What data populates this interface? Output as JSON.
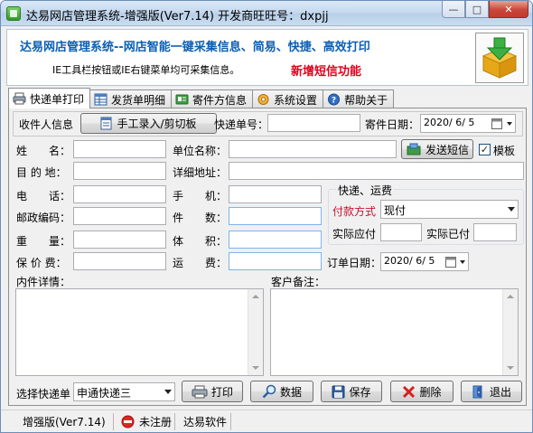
{
  "window": {
    "title": "达易网店管理系统-增强版(Ver7.14) 开发商旺旺号：dxpjj",
    "minimize": "—",
    "maximize": "□",
    "close": "✕"
  },
  "banner": {
    "headline": "达易网店管理系统--网店智能一键采集信息、简易、快捷、高效打印",
    "hint": "IE工具栏按钮或IE右键菜单均可采集信息。",
    "promo": "新增短信功能",
    "logo_icon": "download-box-icon"
  },
  "tabs": [
    {
      "label": "快递单打印",
      "icon": "printer-icon"
    },
    {
      "label": "发货单明细",
      "icon": "table-icon"
    },
    {
      "label": "寄件方信息",
      "icon": "contact-card-icon"
    },
    {
      "label": "系统设置",
      "icon": "gear-hand-icon"
    },
    {
      "label": "帮助关于",
      "icon": "help-icon"
    }
  ],
  "header": {
    "section_label": "收件人信息",
    "manual_button": "手工录入/剪切板",
    "tracking_label": "快递单号：",
    "tracking_value": "",
    "date_label": "寄件日期：",
    "date_value": "2020/ 6/ 5"
  },
  "form": {
    "name_label": "姓　　名：",
    "company_label": "单位名称：",
    "sms_button": "发送短信",
    "template_label": "模板",
    "template_checked": "✓",
    "dest_label": "目 的 地：",
    "address_label": "详细地址：",
    "phone_label": "电　　话：",
    "mobile_label": "手　　机：",
    "postcode_label": "邮政编码：",
    "pieces_label": "件　　数：",
    "weight_label": "重　　量：",
    "volume_label": "体　　积：",
    "insured_label": "保 价 费：",
    "freight_label": "运　　费：",
    "order_date_label": "订单日期：",
    "order_date_value": "2020/ 6/ 5",
    "contents_label": "内件详情：",
    "remark_label": "客户备注："
  },
  "shipping_group": {
    "title": "快递、运费",
    "payment_label": "付款方式",
    "payment_value": "现付",
    "payable_label": "实际应付",
    "paid_label": "实际已付"
  },
  "bottom": {
    "courier_label": "选择快递单",
    "courier_value": "申通快递三",
    "print_button": "打印",
    "data_button": "数据",
    "save_button": "保存",
    "delete_button": "删除",
    "exit_button": "退出"
  },
  "status": {
    "version": "增强版(Ver7.14)",
    "registration": "未注册",
    "company": "达易软件"
  },
  "colors": {
    "banner_blue": "#0a5fb4",
    "promo_red": "#e0001b",
    "payment_label_red": "#c8102e"
  }
}
